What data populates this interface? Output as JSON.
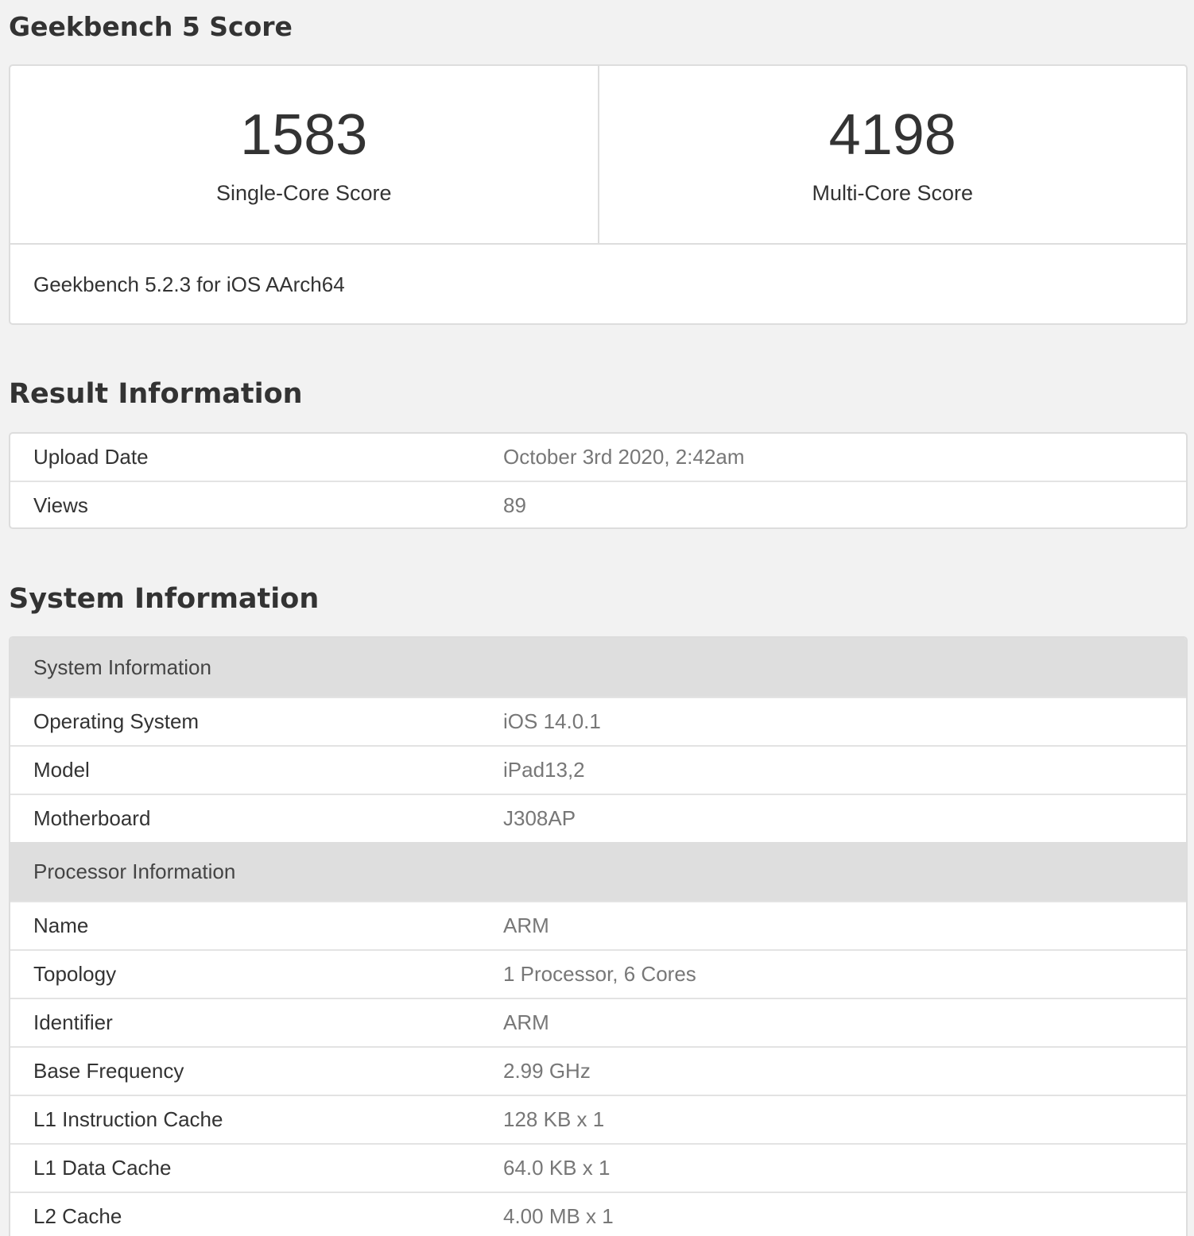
{
  "score_section": {
    "title": "Geekbench 5 Score",
    "single_core": {
      "value": "1583",
      "label": "Single-Core Score"
    },
    "multi_core": {
      "value": "4198",
      "label": "Multi-Core Score"
    },
    "version": "Geekbench 5.2.3 for iOS AArch64"
  },
  "result_section": {
    "title": "Result Information",
    "rows": [
      {
        "name": "Upload Date",
        "value": "October 3rd 2020, 2:42am"
      },
      {
        "name": "Views",
        "value": "89"
      }
    ]
  },
  "system_section": {
    "title": "System Information",
    "groups": [
      {
        "header": "System Information",
        "rows": [
          {
            "name": "Operating System",
            "value": "iOS 14.0.1"
          },
          {
            "name": "Model",
            "value": "iPad13,2"
          },
          {
            "name": "Motherboard",
            "value": "J308AP"
          }
        ]
      },
      {
        "header": "Processor Information",
        "rows": [
          {
            "name": "Name",
            "value": "ARM"
          },
          {
            "name": "Topology",
            "value": "1 Processor, 6 Cores"
          },
          {
            "name": "Identifier",
            "value": "ARM"
          },
          {
            "name": "Base Frequency",
            "value": "2.99 GHz"
          },
          {
            "name": "L1 Instruction Cache",
            "value": "128 KB x 1"
          },
          {
            "name": "L1 Data Cache",
            "value": "64.0 KB x 1"
          },
          {
            "name": "L2 Cache",
            "value": "4.00 MB x 1"
          }
        ]
      }
    ]
  }
}
